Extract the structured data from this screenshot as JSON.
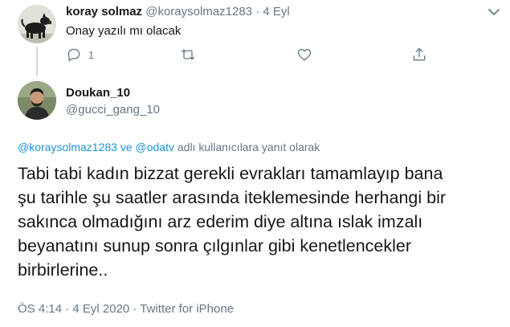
{
  "parent_tweet": {
    "name": "koray solmaz",
    "handle": "@koraysolmaz1283",
    "separator": "·",
    "date": "4 Eyl",
    "text": "Onay yazılı mı olacak",
    "reply_count": "1",
    "icons": [
      "more-icon",
      "reply-icon",
      "retweet-icon",
      "like-icon",
      "share-icon"
    ]
  },
  "main_tweet": {
    "name": "Doukan_10",
    "handle": "@gucci_gang_10",
    "reply_context": {
      "mention_1": "@koraysolmaz1283",
      "joiner": "ve",
      "mention_2": "@odatv",
      "suffix": "adlı kullanıcılara yanıt olarak"
    },
    "body_lines": [
      "Tabi tabi kadın bizzat gerekli evrakları tamamlayıp bana",
      "şu tarihle şu saatler arasında iteklemesinde herhangi bir",
      "sakınca olmadığını arz ederim diye altına ıslak imzalı",
      "beyanatını sunup sonra çılgınlar gibi kenetlencekler",
      "birbirlerine.."
    ],
    "meta": "ÖS 4:14 · 4 Eyl 2020 · Twitter for iPhone"
  },
  "colors": {
    "text": "#14171a",
    "secondary": "#657786",
    "link": "#1b95e0",
    "thread_line": "#cfd9de"
  }
}
